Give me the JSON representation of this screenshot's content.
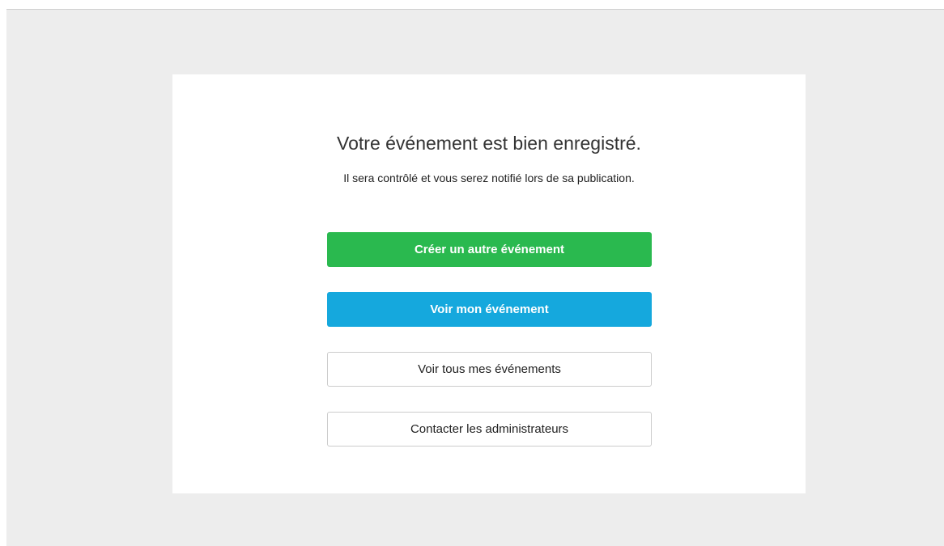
{
  "confirmation": {
    "title": "Votre événement est bien enregistré.",
    "subtitle": "Il sera contrôlé et vous serez notifié lors de sa publication."
  },
  "actions": {
    "create_another": "Créer un autre événement",
    "view_event": "Voir mon événement",
    "view_all_events": "Voir tous mes événements",
    "contact_admins": "Contacter les administrateurs"
  },
  "colors": {
    "primary_green": "#2ab94f",
    "primary_blue": "#15a8dd",
    "background": "#ededed"
  }
}
